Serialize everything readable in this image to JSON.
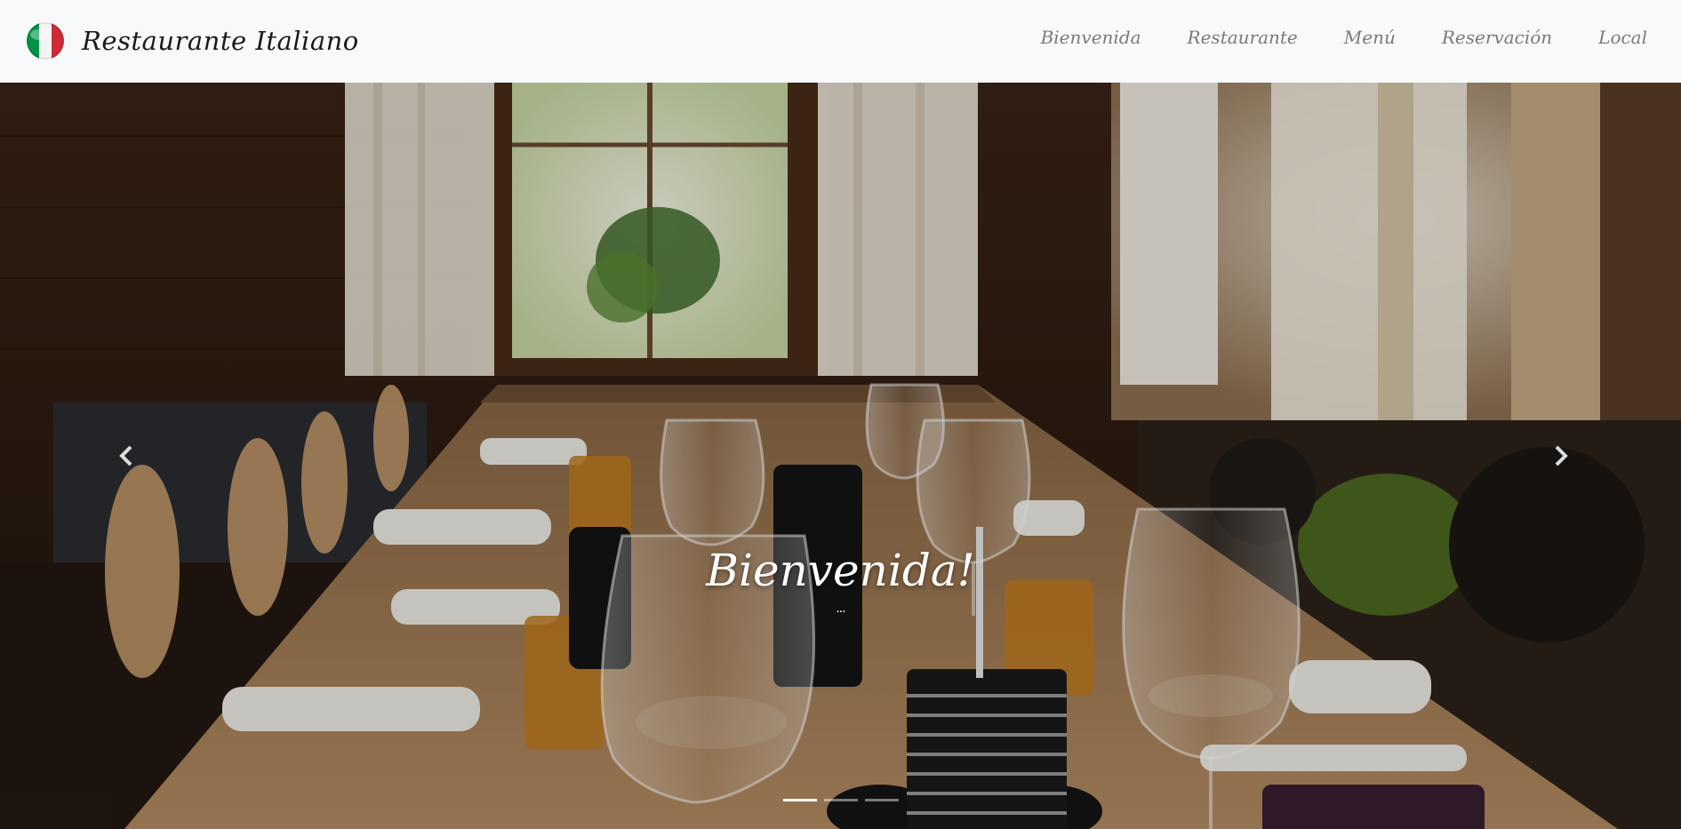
{
  "navbar": {
    "brand_name": "Restaurante Italiano",
    "logo_icon": "italian-flag-icon",
    "links": [
      {
        "label": "Bienvenida"
      },
      {
        "label": "Restaurante"
      },
      {
        "label": "Menú"
      },
      {
        "label": "Reservación"
      },
      {
        "label": "Local"
      }
    ]
  },
  "hero": {
    "caption_title": "Bienvenida!",
    "caption_sub": "...",
    "prev_icon": "chevron-left-icon",
    "next_icon": "chevron-right-icon",
    "slides_count": 3,
    "active_slide": 1
  },
  "colors": {
    "navbar_bg": "#f8f9fa",
    "brand_text": "#1b1b1b",
    "nav_link": "#7a7a7a",
    "flag_green": "#009246",
    "flag_white": "#ffffff",
    "flag_red": "#ce2b37"
  }
}
